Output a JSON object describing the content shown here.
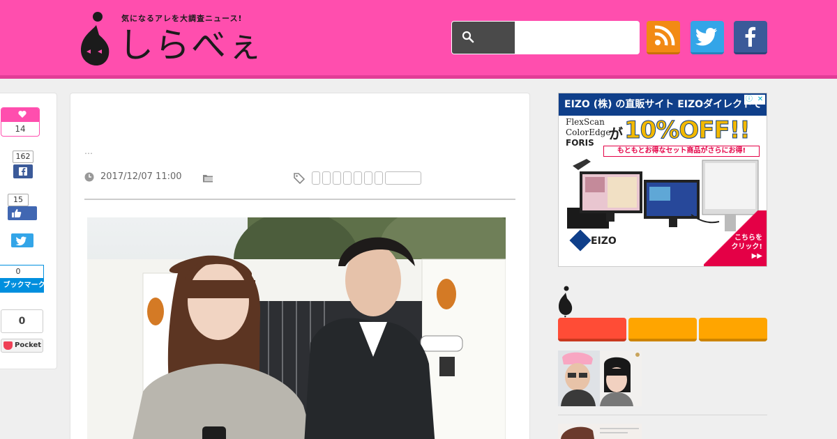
{
  "header": {
    "logo_text": "しらべぇ",
    "tagline": "気になるアレを大調査ニュース!",
    "search_placeholder": ""
  },
  "share": {
    "like_count": "14",
    "facebook_share_count": "162",
    "facebook_like_count": "15",
    "hatena_count": "0",
    "hatena_label": "B! ブックマーク",
    "pocket_count": "0",
    "pocket_label": "Pocket"
  },
  "article": {
    "excerpt": "…",
    "date": "2017/12/07 11:00"
  },
  "ad": {
    "headline": "EIZO (株) の直販サイト EIZOダイレクトで",
    "brands": [
      "FlexScan",
      "ColorEdge",
      "FORIS"
    ],
    "ga": "が",
    "offer": "10%OFF!!",
    "sub": "もともとお得なセット商品がさらにお得!",
    "brand_logo": "EIZO",
    "click": "こちらを\nクリック!\n▶▶"
  },
  "colors": {
    "brand_pink": "#ff4eae",
    "rss": "#f28a14",
    "twitter": "#33a5e8",
    "facebook": "#3b5a99",
    "tab_red": "#ff4c36",
    "tab_orange": "#ffa500"
  },
  "icons": [
    "search-icon",
    "rss-icon",
    "twitter-icon",
    "facebook-icon",
    "heart-icon",
    "clock-icon",
    "folder-icon",
    "tag-icon"
  ]
}
